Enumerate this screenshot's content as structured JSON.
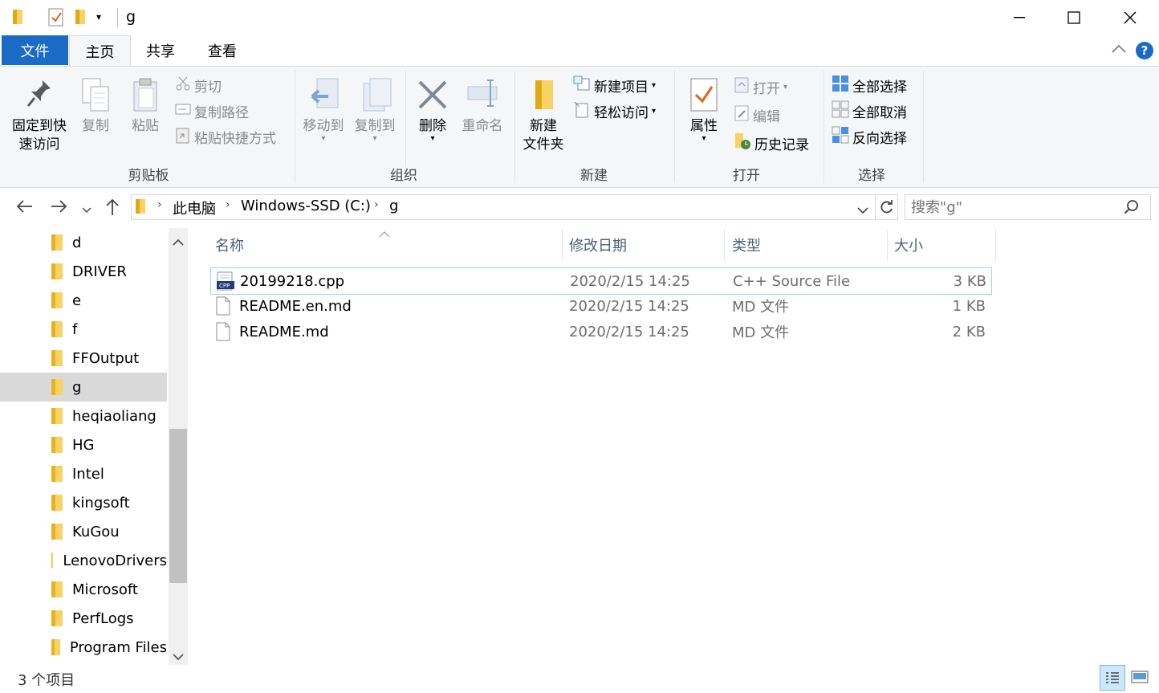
{
  "window": {
    "title": "g",
    "controls": {
      "minimize": "—",
      "maximize": "☐",
      "close": "✕"
    }
  },
  "tabs": [
    {
      "label": "文件"
    },
    {
      "label": "主页"
    },
    {
      "label": "共享"
    },
    {
      "label": "查看"
    }
  ],
  "ribbon": {
    "clipboard": {
      "label": "剪贴板",
      "pin_line1": "固定到快",
      "pin_line2": "速访问",
      "copy": "复制",
      "paste": "粘贴",
      "cut": "剪切",
      "copy_path": "复制路径",
      "paste_shortcut": "粘贴快捷方式"
    },
    "organize": {
      "label": "组织",
      "move_to": "移动到",
      "copy_to": "复制到",
      "delete": "删除",
      "rename": "重命名"
    },
    "new": {
      "label": "新建",
      "new_folder_line1": "新建",
      "new_folder_line2": "文件夹",
      "new_item": "新建项目",
      "easy_access": "轻松访问"
    },
    "open": {
      "label": "打开",
      "properties": "属性",
      "open": "打开",
      "edit": "编辑",
      "history": "历史记录"
    },
    "select": {
      "label": "选择",
      "select_all": "全部选择",
      "select_none": "全部取消",
      "invert": "反向选择"
    }
  },
  "address": {
    "crumbs": [
      "此电脑",
      "Windows-SSD (C:)",
      "g"
    ],
    "search_placeholder": "搜索\"g\""
  },
  "nav": [
    "d",
    "DRIVER",
    "e",
    "f",
    "FFOutput",
    "g",
    "heqiaoliang",
    "HG",
    "Intel",
    "kingsoft",
    "KuGou",
    "LenovoDrivers",
    "Microsoft",
    "PerfLogs",
    "Program Files"
  ],
  "nav_selected": "g",
  "columns": {
    "name": "名称",
    "modified": "修改日期",
    "type": "类型",
    "size": "大小"
  },
  "files": [
    {
      "name": "20199218.cpp",
      "modified": "2020/2/15 14:25",
      "type": "C++ Source File",
      "size": "3 KB",
      "icon": "cpp-file-icon"
    },
    {
      "name": "README.en.md",
      "modified": "2020/2/15 14:25",
      "type": "MD 文件",
      "size": "1 KB",
      "icon": "file-icon"
    },
    {
      "name": "README.md",
      "modified": "2020/2/15 14:25",
      "type": "MD 文件",
      "size": "2 KB",
      "icon": "file-icon"
    }
  ],
  "status": {
    "count": "3 个项目"
  },
  "colors": {
    "accent": "#1a6ac6",
    "selection": "#cce8ff",
    "nav_selected": "#d9d9d9"
  }
}
